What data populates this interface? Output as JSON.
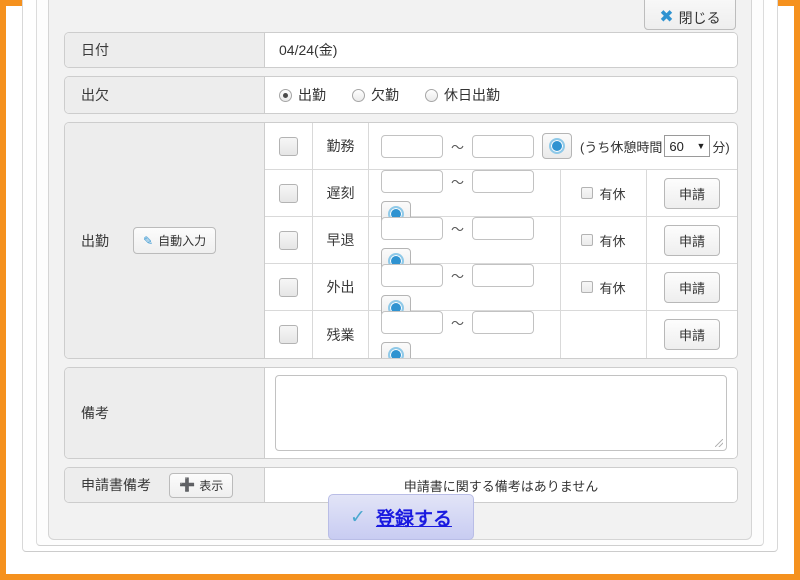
{
  "window": {
    "close_button": {
      "label": "閉じる",
      "icon": "close-x-icon"
    }
  },
  "form": {
    "date": {
      "label": "日付",
      "value": "04/24(金)"
    },
    "attendance": {
      "label": "出欠",
      "options": [
        {
          "label": "出勤",
          "selected": true
        },
        {
          "label": "欠勤",
          "selected": false
        },
        {
          "label": "休日出勤",
          "selected": false
        }
      ]
    },
    "work": {
      "label": "出勤",
      "auto_input_button": {
        "label": "自動入力",
        "icon": "pencil-icon"
      },
      "separator": "〜",
      "rows": [
        {
          "name": "勤務",
          "checked": false,
          "start": "",
          "end": "",
          "has_break": true,
          "break_prefix": "(うち休憩時間",
          "break_value": "60",
          "break_suffix": "分)",
          "has_paid_leave": false,
          "paid_leave_label": "",
          "has_apply": false,
          "apply_label": ""
        },
        {
          "name": "遅刻",
          "checked": false,
          "start": "",
          "end": "",
          "has_break": false,
          "has_paid_leave": true,
          "paid_leave_label": "有休",
          "paid_leave_checked": false,
          "has_apply": true,
          "apply_label": "申請"
        },
        {
          "name": "早退",
          "checked": false,
          "start": "",
          "end": "",
          "has_break": false,
          "has_paid_leave": true,
          "paid_leave_label": "有休",
          "paid_leave_checked": false,
          "has_apply": true,
          "apply_label": "申請"
        },
        {
          "name": "外出",
          "checked": false,
          "start": "",
          "end": "",
          "has_break": false,
          "has_paid_leave": true,
          "paid_leave_label": "有休",
          "paid_leave_checked": false,
          "has_apply": true,
          "apply_label": "申請"
        },
        {
          "name": "残業",
          "checked": false,
          "start": "",
          "end": "",
          "has_break": false,
          "has_paid_leave": false,
          "paid_leave_label": "",
          "has_apply": true,
          "apply_label": "申請"
        }
      ]
    },
    "remarks": {
      "label": "備考",
      "value": ""
    },
    "application_remarks": {
      "label": "申請書備考",
      "show_button": {
        "label": "表示",
        "icon": "plus-icon"
      },
      "message": "申請書に関する備考はありません"
    },
    "submit": {
      "label": "登録する",
      "icon": "check-icon"
    }
  },
  "colors": {
    "frame": "#f5911e",
    "accent_blue": "#2f93d1",
    "submit_text": "#1a1ae0",
    "label_bg": "#ededed"
  }
}
